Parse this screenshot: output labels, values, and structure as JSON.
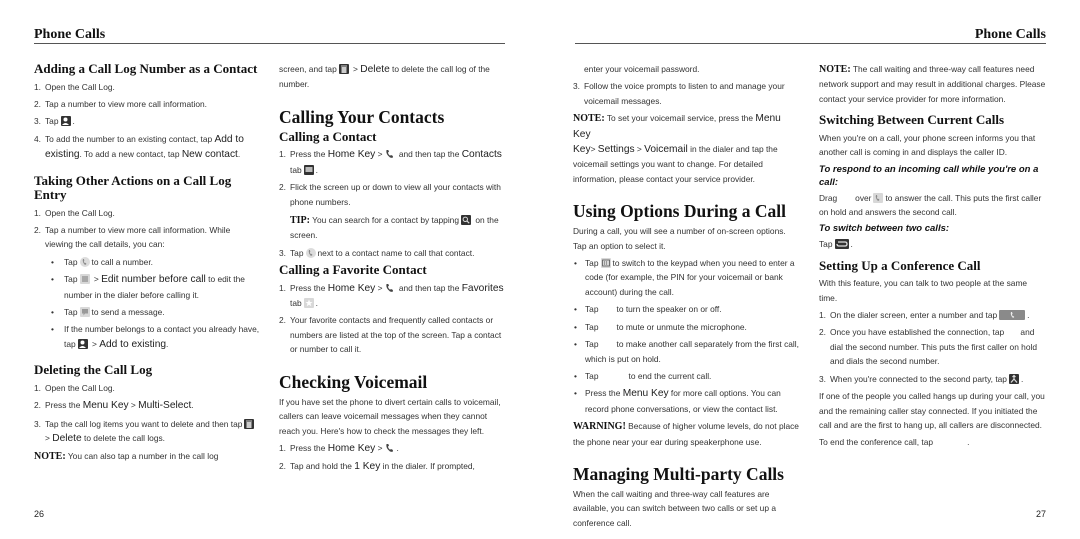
{
  "running_head": "Phone Calls",
  "folios": {
    "left": "26",
    "right": "27"
  },
  "col1": {
    "h_adding": "Adding a Call Log Number as a Contact",
    "adding_steps": [
      "Open the Call Log.",
      "Tap a number to view more call information.",
      "Tap",
      "To add the number to an existing contact, tap"
    ],
    "adding_step4_ui1": "Add to existing",
    "adding_step4_mid": ". To add a new contact, tap ",
    "adding_step4_ui2": "New contact",
    "adding_step4_end": ".",
    "h_taking": "Taking Other Actions on a Call Log Entry",
    "taking_steps": [
      "Open the Call Log.",
      "Tap a number to view more call information. While viewing the call details, you can:"
    ],
    "taking_bullets": {
      "b1_pre": "Tap",
      "b1_post": "to call a number.",
      "b2_pre": "Tap",
      "b2_sep": " > ",
      "b2_ui": "Edit number before call",
      "b2_post": " to edit the number in the dialer before calling it.",
      "b3_pre": "Tap",
      "b3_post": "to send a message.",
      "b4_pre": "If the number belongs to a contact you already have, tap",
      "b4_sep": " > ",
      "b4_ui": "Add to existing",
      "b4_post": "."
    },
    "h_deleting": "Deleting the Call Log",
    "deleting_steps": {
      "s1": "Open the Call Log.",
      "s2_pre": "Press the ",
      "s2_ui1": "Menu Key",
      "s2_sep": " > ",
      "s2_ui2": "Multi-Select",
      "s2_end": ".",
      "s3_pre": "Tap the call log items you want to delete and then tap",
      "s3_sep": " > ",
      "s3_ui": "Delete",
      "s3_post": " to delete the call logs."
    },
    "note_label": "NOTE:",
    "note_text": " You can also tap a number in the call log"
  },
  "col2": {
    "cont_pre": "screen, and tap",
    "cont_sep": " > ",
    "cont_ui": "Delete",
    "cont_post": " to delete the call log of the number.",
    "h_calling_contacts": "Calling Your Contacts",
    "h_calling_contact": "Calling a Contact",
    "cc_s1_pre": "Press the ",
    "cc_s1_ui": "Home Key",
    "cc_s1_sep": " >",
    "cc_s1_mid": " and then tap the ",
    "cc_s1_ui2": "Contacts",
    "cc_s1_tab": " tab",
    "cc_s1_end": ".",
    "cc_s2": "Flick the screen up or down to view all your contacts with phone numbers.",
    "tip_label": "TIP:",
    "tip_text": " You can search for a contact by tapping",
    "tip_end": " on the screen.",
    "cc_s3_pre": "Tap",
    "cc_s3_post": "next to a contact name to call that contact.",
    "h_favorite": "Calling a Favorite Contact",
    "fav_s1_pre": "Press the ",
    "fav_s1_ui": "Home Key",
    "fav_s1_sep": " >",
    "fav_s1_mid": " and then tap the ",
    "fav_s1_ui2": "Favorites",
    "fav_s1_tab": " tab",
    "fav_s1_end": ".",
    "fav_s2": "Your favorite contacts and frequently called contacts or numbers are listed at the top of the screen. Tap a contact or number to call it.",
    "h_voicemail": "Checking Voicemail",
    "vm_intro": "If you have set the phone to divert certain calls to voicemail, callers can leave voicemail messages when they cannot reach you. Here's how to check the messages they left.",
    "vm_s1_pre": "Press the ",
    "vm_s1_ui": "Home Key",
    "vm_s1_sep": " >",
    "vm_s1_end": ".",
    "vm_s2_pre": "Tap and hold the ",
    "vm_s2_ui": "1 Key",
    "vm_s2_post": " in the dialer. If prompted,"
  },
  "col3": {
    "vm_cont": "enter your voicemail password.",
    "vm_s3": "Follow the voice prompts to listen to and manage your voicemail messages.",
    "note_label": "NOTE:",
    "note_pre": " To set your voicemail service, press the ",
    "note_ui1": "Menu Key",
    "note_sep1": "> ",
    "note_ui2": "Settings",
    "note_sep2": " > ",
    "note_ui3": "Voicemail",
    "note_post": " in the dialer and tap the voicemail settings you want to change. For detailed information, please contact your service provider.",
    "h_options": "Using Options During a Call",
    "options_intro": "During a call, you will see a number of on-screen options. Tap an option to select it.",
    "opt_b1_pre": "Tap",
    "opt_b1_post": "to switch to the keypad when you need to enter a code (for example, the PIN for your voicemail or bank account) during the call.",
    "opt_b2_pre": "Tap",
    "opt_b2_post": "to turn the speaker on or off.",
    "opt_b3_pre": "Tap",
    "opt_b3_post": "to mute or unmute the microphone.",
    "opt_b4_pre": "Tap",
    "opt_b4_post": "to make another call separately from the first call, which is put on hold.",
    "opt_b5_pre": "Tap",
    "opt_b5_post": "to end the current call.",
    "opt_b6_pre": "Press the ",
    "opt_b6_ui": "Menu Key",
    "opt_b6_post": " for more call options. You can record phone conversations, or view the contact list.",
    "warning_label": "WARNING!",
    "warning_text": " Because of higher volume levels, do not place the phone near your ear during speakerphone use.",
    "h_multiparty": "Managing Multi-party Calls",
    "multiparty_intro": "When the call waiting and three-way call features are available, you can switch between two calls or set up a conference call."
  },
  "col4": {
    "note_label": "NOTE:",
    "note_text": " The call waiting and three-way call features need network support and may result in additional charges. Please contact your service provider for more information.",
    "h_switching": "Switching Between Current Calls",
    "switching_intro": "When you're on a call, your phone screen informs you that another call is coming in and displays the caller ID.",
    "h_respond": "To respond to an incoming call while you're on a call:",
    "respond_pre": "Drag",
    "respond_mid": "over",
    "respond_post": "to answer the call. This puts the first caller on hold and answers the second call.",
    "h_switch_two": "To switch between two calls:",
    "switch_pre": "Tap",
    "switch_end": ".",
    "h_conference": "Setting Up a Conference Call",
    "conf_intro": "With this feature, you can talk to two people at the same time.",
    "conf_s1_pre": "On the dialer screen, enter a number and tap",
    "conf_s1_end": ".",
    "conf_s2": "Once you have established the connection, tap       and dial the second number. This puts the first caller on hold and dials the second number.",
    "conf_s3_pre": "When you're connected to the second party, tap",
    "conf_s3_end": ".",
    "conf_para": "If one of the people you called hangs up during your call, you and the remaining caller stay connected. If you initiated the call and are the first to hang up, all callers are disconnected.",
    "conf_end_pre": "To end the conference call, tap",
    "conf_end_post": "."
  }
}
